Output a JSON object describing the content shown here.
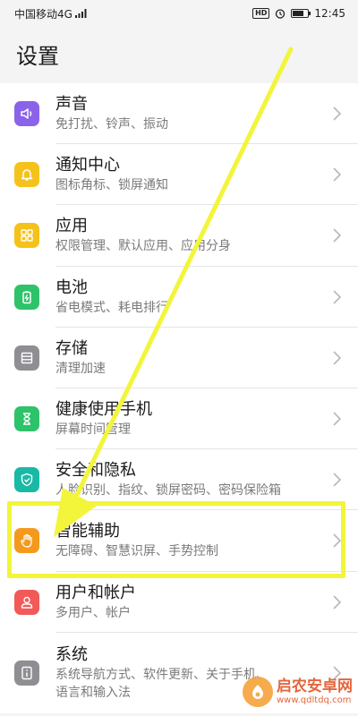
{
  "status_bar": {
    "carrier": "中国移动4G",
    "network_tag": "4G",
    "hd_badge": "HD",
    "time": "12:45"
  },
  "page": {
    "title": "设置"
  },
  "colors": {
    "yellow_annotation": "#f2f53a",
    "chevron": "#b8b8b8"
  },
  "items": [
    {
      "title": "声音",
      "subtitle": "免打扰、铃声、振动",
      "icon": "speaker-icon",
      "color": "#8b63e8"
    },
    {
      "title": "通知中心",
      "subtitle": "图标角标、锁屏通知",
      "icon": "bell-icon",
      "color": "#f5c21b"
    },
    {
      "title": "应用",
      "subtitle": "权限管理、默认应用、应用分身",
      "icon": "apps-grid-icon",
      "color": "#f5c21b"
    },
    {
      "title": "电池",
      "subtitle": "省电模式、耗电排行",
      "icon": "battery-icon",
      "color": "#2ec26a"
    },
    {
      "title": "存储",
      "subtitle": "清理加速",
      "icon": "storage-icon",
      "color": "#8e8e93"
    },
    {
      "title": "健康使用手机",
      "subtitle": "屏幕时间管理",
      "icon": "hourglass-icon",
      "color": "#2ec26a"
    },
    {
      "title": "安全和隐私",
      "subtitle": "人脸识别、指纹、锁屏密码、密码保险箱",
      "icon": "shield-check-icon",
      "color": "#19b9a6"
    },
    {
      "title": "智能辅助",
      "subtitle": "无障碍、智慧识屏、手势控制",
      "icon": "hand-icon",
      "color": "#f39a1e"
    },
    {
      "title": "用户和帐户",
      "subtitle": "多用户、帐户",
      "icon": "user-icon",
      "color": "#f25a5a"
    },
    {
      "title": "系统",
      "subtitle": "系统导航方式、软件更新、关于手机、",
      "subtitle2": "语言和输入法",
      "icon": "info-icon",
      "color": "#8e8e93"
    }
  ],
  "watermark": {
    "main": "启农安卓网",
    "sub": "www.qdltdq.com"
  }
}
